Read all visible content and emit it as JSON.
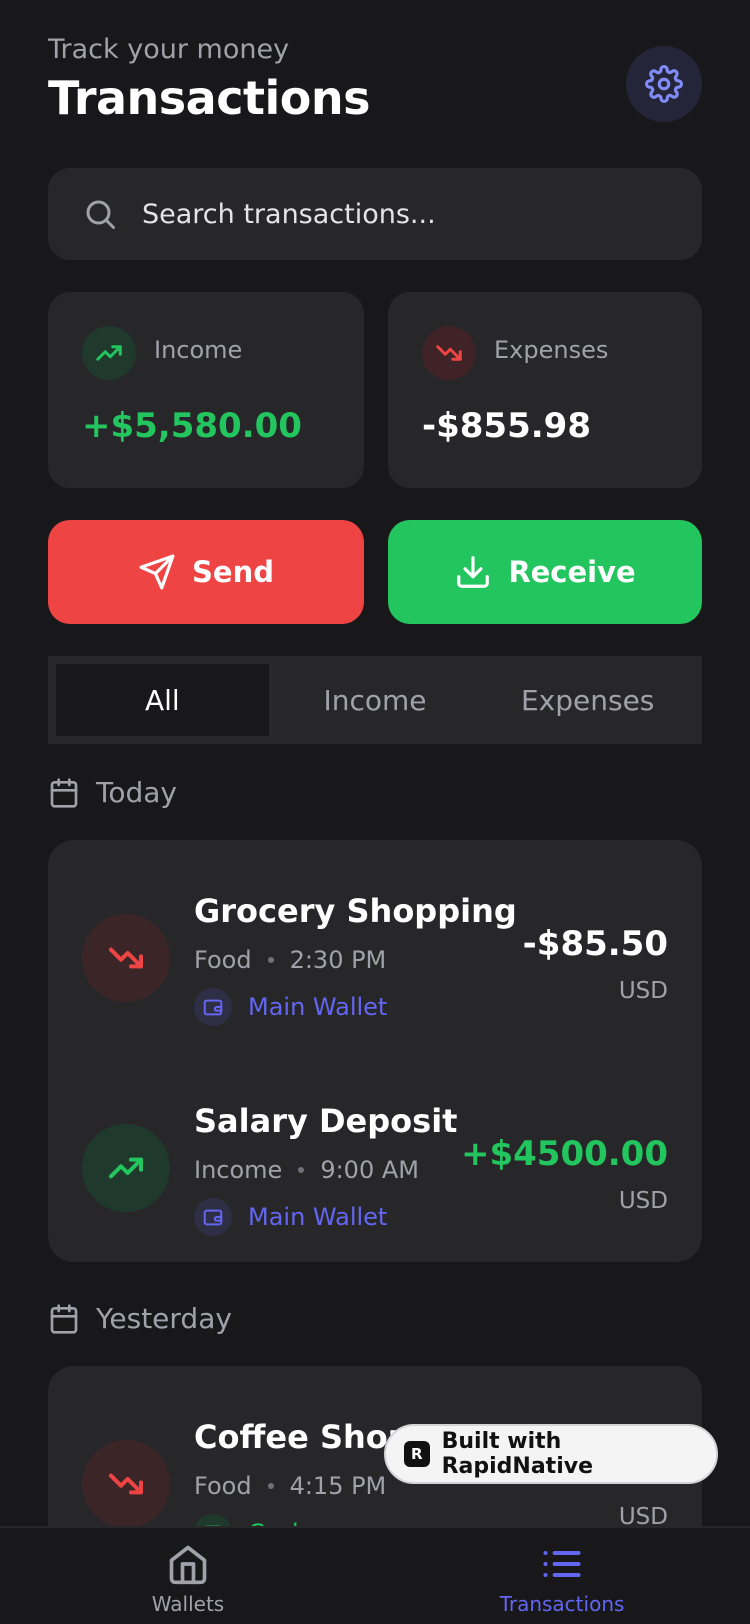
{
  "header": {
    "subtitle": "Track your money",
    "title": "Transactions"
  },
  "search": {
    "placeholder": "Search transactions..."
  },
  "summary": {
    "income": {
      "label": "Income",
      "value": "+$5,580.00"
    },
    "expenses": {
      "label": "Expenses",
      "value": "-$855.98"
    }
  },
  "actions": {
    "send": "Send",
    "receive": "Receive"
  },
  "tabs": [
    {
      "label": "All",
      "active": true
    },
    {
      "label": "Income",
      "active": false
    },
    {
      "label": "Expenses",
      "active": false
    }
  ],
  "groups": [
    {
      "date_label": "Today",
      "transactions": [
        {
          "title": "Grocery Shopping",
          "category": "Food",
          "time": "2:30 PM",
          "wallet": "Main Wallet",
          "amount": "-$85.50",
          "currency": "USD",
          "type": "expense"
        },
        {
          "title": "Salary Deposit",
          "category": "Income",
          "time": "9:00 AM",
          "wallet": "Main Wallet",
          "amount": "+$4500.00",
          "currency": "USD",
          "type": "income"
        }
      ]
    },
    {
      "date_label": "Yesterday",
      "transactions": [
        {
          "title": "Coffee Shop",
          "category": "Food",
          "time": "4:15 PM",
          "wallet": "Cash",
          "amount": "",
          "currency": "USD",
          "type": "expense"
        }
      ]
    }
  ],
  "bottom_nav": [
    {
      "label": "Wallets",
      "icon": "home-icon",
      "active": false
    },
    {
      "label": "Transactions",
      "icon": "list-icon",
      "active": true
    }
  ],
  "badge": {
    "text": "Built with RapidNative"
  },
  "colors": {
    "background": "#18181b",
    "card": "#27272a",
    "income": "#22c55e",
    "expense": "#ef4444",
    "accent": "#6366f1"
  }
}
